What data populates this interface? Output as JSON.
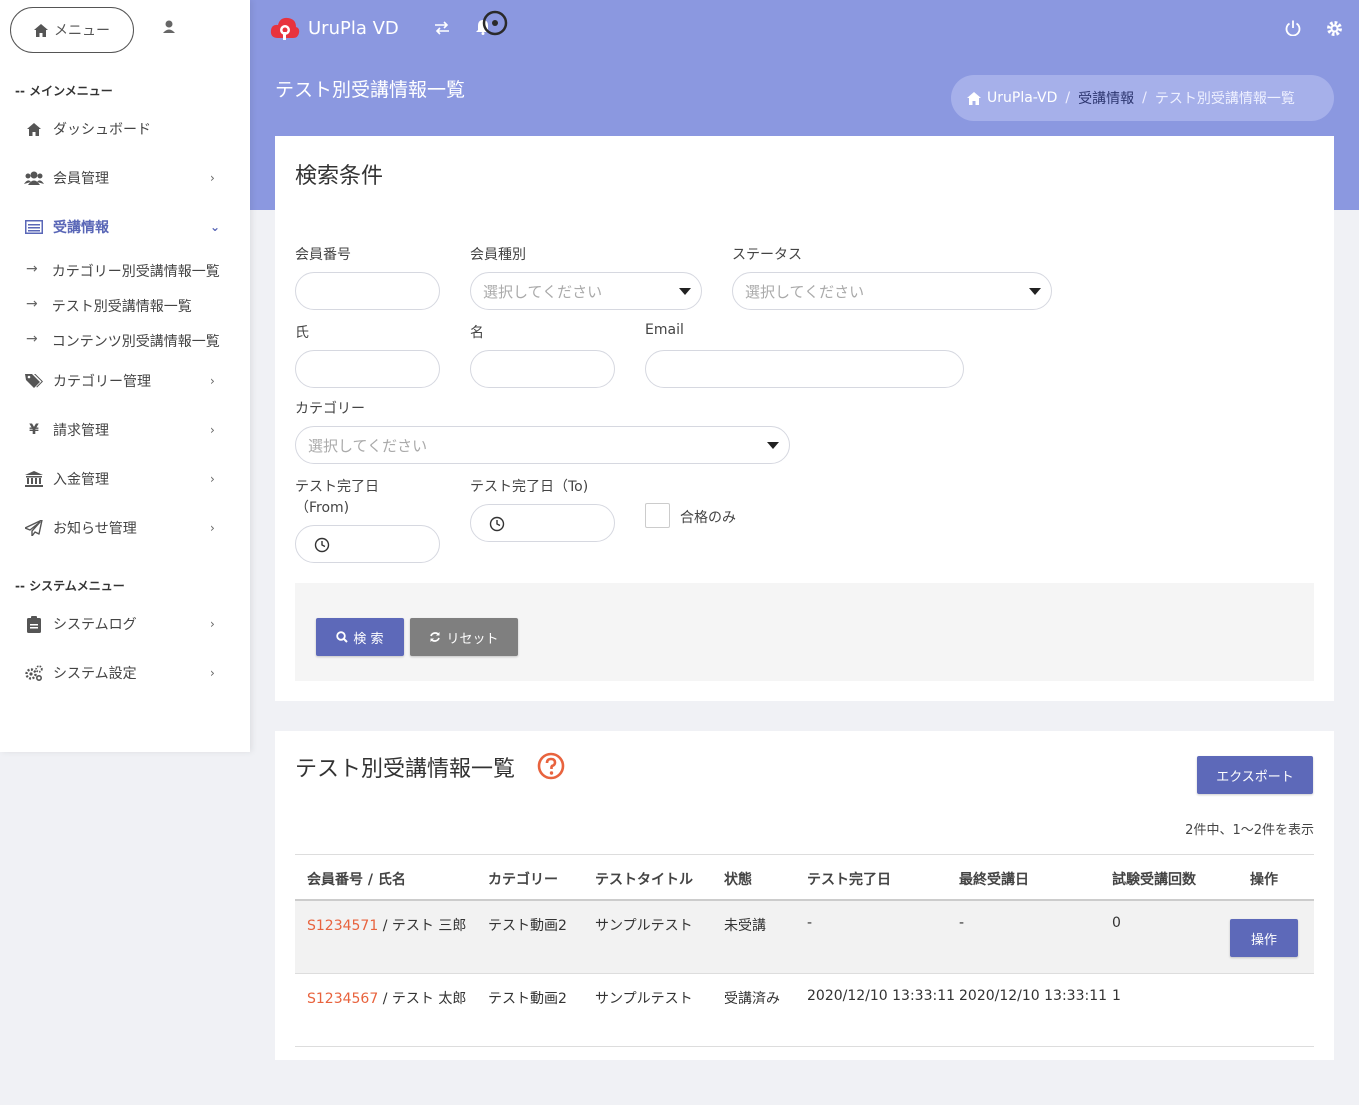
{
  "sidebar": {
    "menu_label": "メニュー",
    "main_menu_heading": "-- メインメニュー",
    "system_menu_heading": "-- システムメニュー",
    "items": [
      {
        "label": "ダッシュボード",
        "icon": "home-icon"
      },
      {
        "label": "会員管理",
        "icon": "users-icon"
      },
      {
        "label": "受講情報",
        "icon": "list-icon"
      },
      {
        "label": "カテゴリー管理",
        "icon": "tags-icon"
      },
      {
        "label": "請求管理",
        "icon": "yen-icon"
      },
      {
        "label": "入金管理",
        "icon": "bank-icon"
      },
      {
        "label": "お知らせ管理",
        "icon": "paper-plane-icon"
      }
    ],
    "sub_items": [
      {
        "arrow": "→",
        "label": "カテゴリー別受講情報一覧"
      },
      {
        "arrow": "→",
        "label": "テスト別受講情報一覧"
      },
      {
        "arrow": "→",
        "label": "コンテンツ別受講情報一覧"
      }
    ],
    "system_items": [
      {
        "label": "システムログ",
        "icon": "clipboard-icon"
      },
      {
        "label": "システム設定",
        "icon": "cogs-icon"
      }
    ]
  },
  "header": {
    "brand": "UruPla VD",
    "page_title": "テスト別受講情報一覧",
    "breadcrumb": [
      "UruPla-VD",
      "受講情報",
      "テスト別受講情報一覧"
    ]
  },
  "search": {
    "title": "検索条件",
    "member_no_label": "会員番号",
    "member_type_label": "会員種別",
    "member_type_placeholder": "選択してください",
    "status_label": "ステータス",
    "status_placeholder": "選択してください",
    "last_name_label": "氏",
    "first_name_label": "名",
    "email_label": "Email",
    "category_label": "カテゴリー",
    "category_placeholder": "選択してください",
    "date_from_label": "テスト完了日",
    "date_from_label2": "（From)",
    "date_to_label": "テスト完了日（To)",
    "pass_only_label": "合格のみ",
    "search_button": "検 索",
    "reset_button": "リセット"
  },
  "results": {
    "title": "テスト別受講情報一覧",
    "export_button": "エクスポート",
    "count_text": "2件中、1〜2件を表示",
    "columns": [
      "会員番号 / 氏名",
      "カテゴリー",
      "テストタイトル",
      "状態",
      "テスト完了日",
      "最終受講日",
      "試験受講回数",
      "操作"
    ],
    "rows": [
      {
        "member_no": "S1234571",
        "name": " / テスト 三郎",
        "category": "テスト動画2",
        "test_title": "サンプルテスト",
        "status": "未受講",
        "completed": "-",
        "last_date": "-",
        "attempts": "0",
        "action": "操作"
      },
      {
        "member_no": "S1234567",
        "name": " / テスト 太郎",
        "category": "テスト動画2",
        "test_title": "サンプルテスト",
        "status": "受講済み",
        "completed": "2020/12/10 13:33:11",
        "last_date": "2020/12/10 13:33:11",
        "attempts": "1",
        "action": ""
      }
    ]
  },
  "colors": {
    "header_bg": "#8b98e0",
    "primary_button": "#5d69b9",
    "link": "#e8633e",
    "help_icon": "#e8633e"
  }
}
